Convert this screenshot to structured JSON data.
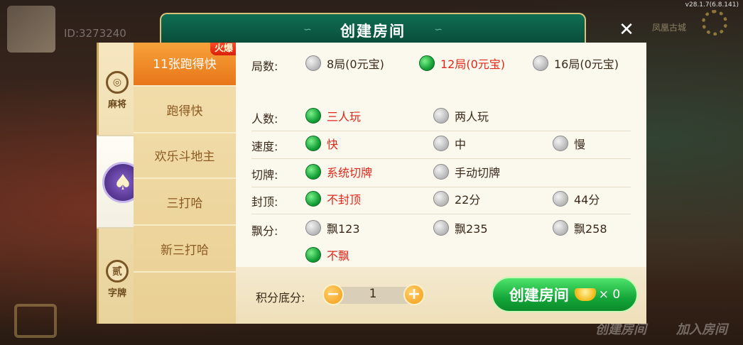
{
  "version": "v28.1.7(6.8.141)",
  "background": {
    "user_id": "ID:3273240",
    "top_right_label": "凤凰古城",
    "bottom_create": "创建房间",
    "bottom_join": "加入房间"
  },
  "dialog": {
    "title": "创建房间",
    "close_symbol": "✕"
  },
  "categories": [
    {
      "label": "麻将",
      "icon": "mahjong-icon"
    },
    {
      "label": "",
      "icon": "spade-icon"
    },
    {
      "label": "字牌",
      "icon": "zipai-icon",
      "glyph": "贰"
    }
  ],
  "games": [
    {
      "label": "11张跑得快",
      "badge": "火爆",
      "selected": true
    },
    {
      "label": "跑得快"
    },
    {
      "label": "欢乐斗地主"
    },
    {
      "label": "三打哈"
    },
    {
      "label": "新三打哈"
    }
  ],
  "rules": {
    "rounds": {
      "label": "局数:",
      "options": [
        "8局(0元宝)",
        "12局(0元宝)",
        "16局(0元宝)"
      ],
      "selected": 1
    },
    "players": {
      "label": "人数:",
      "options": [
        "三人玩",
        "两人玩"
      ],
      "selected": 0
    },
    "speed": {
      "label": "速度:",
      "options": [
        "快",
        "中",
        "慢"
      ],
      "selected": 0
    },
    "cut": {
      "label": "切牌:",
      "options": [
        "系统切牌",
        "手动切牌"
      ],
      "selected": 0
    },
    "cap": {
      "label": "封顶:",
      "options": [
        "不封顶",
        "22分",
        "44分"
      ],
      "selected": 0
    },
    "piao": {
      "label": "飘分:",
      "options": [
        "飘123",
        "飘235",
        "飘258",
        "不飘"
      ],
      "selected": 3
    }
  },
  "footer": {
    "score_label": "积分底分:",
    "score_value": "1",
    "minus": "−",
    "plus": "+",
    "create_label": "创建房间",
    "cost": "× 0"
  },
  "colors": {
    "accent_green": "#15a83a",
    "selected_text": "#e0281a",
    "game_selected": "#f29030"
  }
}
